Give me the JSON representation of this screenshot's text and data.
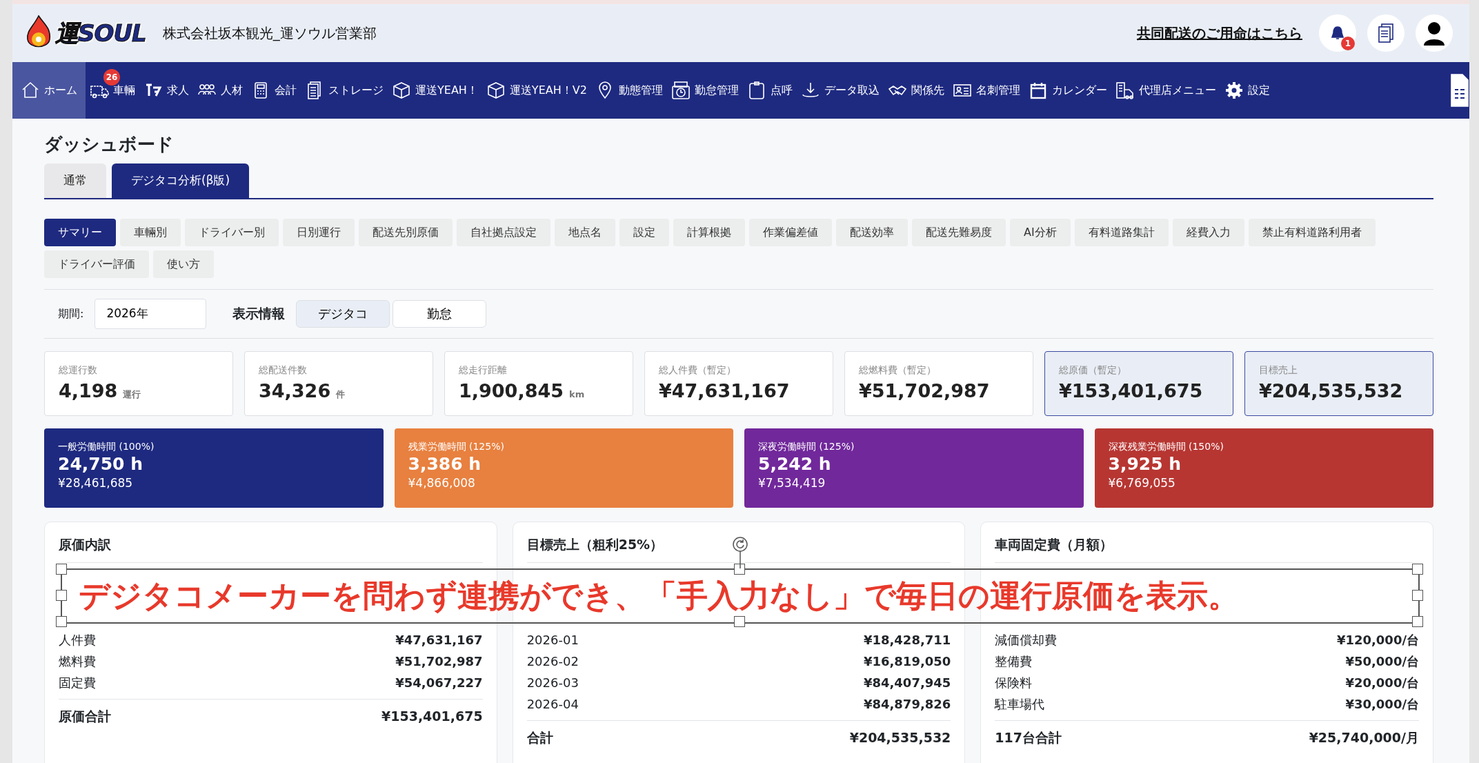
{
  "header": {
    "logo": "運SOUL",
    "company": "株式会社坂本観光_運ソウル営業部",
    "link": "共同配送のご用命はこちら",
    "notification_count": "1"
  },
  "nav": [
    {
      "label": "ホーム",
      "selected": true
    },
    {
      "label": "車輛",
      "selected": false,
      "badge": "26"
    },
    {
      "label": "求人",
      "selected": false
    },
    {
      "label": "人材",
      "selected": false
    },
    {
      "label": "会計",
      "selected": false
    },
    {
      "label": "ストレージ",
      "selected": false
    },
    {
      "label": "運送YEAH！",
      "selected": false
    },
    {
      "label": "運送YEAH！V2",
      "selected": false
    },
    {
      "label": "動態管理",
      "selected": false
    },
    {
      "label": "勤怠管理",
      "selected": false
    },
    {
      "label": "点呼",
      "selected": false
    },
    {
      "label": "データ取込",
      "selected": false
    },
    {
      "label": "関係先",
      "selected": false
    },
    {
      "label": "名刺管理",
      "selected": false
    },
    {
      "label": "カレンダー",
      "selected": false
    },
    {
      "label": "代理店メニュー",
      "selected": false
    },
    {
      "label": "設定",
      "selected": false
    }
  ],
  "page_title": "ダッシュボード",
  "tabs": [
    {
      "label": "通常",
      "selected": false
    },
    {
      "label": "デジタコ分析(β版)",
      "selected": true
    }
  ],
  "subtabs": [
    {
      "label": "サマリー",
      "selected": true
    },
    {
      "label": "車輛別",
      "selected": false
    },
    {
      "label": "ドライバー別",
      "selected": false
    },
    {
      "label": "日別運行",
      "selected": false
    },
    {
      "label": "配送先別原価",
      "selected": false
    },
    {
      "label": "自社拠点設定",
      "selected": false
    },
    {
      "label": "地点名",
      "selected": false
    },
    {
      "label": "設定",
      "selected": false
    },
    {
      "label": "計算根拠",
      "selected": false
    },
    {
      "label": "作業偏差値",
      "selected": false
    },
    {
      "label": "配送効率",
      "selected": false
    },
    {
      "label": "配送先難易度",
      "selected": false
    },
    {
      "label": "AI分析",
      "selected": false
    },
    {
      "label": "有料道路集計",
      "selected": false
    },
    {
      "label": "経費入力",
      "selected": false
    },
    {
      "label": "禁止有料道路利用者",
      "selected": false
    },
    {
      "label": "ドライバー評価",
      "selected": false
    },
    {
      "label": "使い方",
      "selected": false
    }
  ],
  "filters": {
    "period_label": "期間:",
    "period_value": "2026年",
    "display_label": "表示情報",
    "display_options": [
      {
        "label": "デジタコ",
        "selected": true
      },
      {
        "label": "勤怠",
        "selected": false
      }
    ]
  },
  "kpis": [
    {
      "label": "総運行数",
      "value": "4,198",
      "unit": "運行",
      "highlighted": false
    },
    {
      "label": "総配送件数",
      "value": "34,326",
      "unit": "件",
      "highlighted": false
    },
    {
      "label": "総走行距離",
      "value": "1,900,845",
      "unit": "km",
      "highlighted": false
    },
    {
      "label": "総人件費（暫定）",
      "value": "¥47,631,167",
      "highlighted": false
    },
    {
      "label": "総燃料費（暫定）",
      "value": "¥51,702,987",
      "highlighted": false
    },
    {
      "label": "総原価（暫定）",
      "value": "¥153,401,675",
      "highlighted": true
    },
    {
      "label": "目標売上",
      "value": "¥204,535,532",
      "highlighted": true
    }
  ],
  "labor": [
    {
      "label": "一般労働時間 (100%)",
      "hours": "24,750 h",
      "amount": "¥28,461,685",
      "color": "#1e2a80"
    },
    {
      "label": "残業労働時間 (125%)",
      "hours": "3,386 h",
      "amount": "¥4,866,008",
      "color": "#e8803f"
    },
    {
      "label": "深夜労働時間 (125%)",
      "hours": "5,242 h",
      "amount": "¥7,534,419",
      "color": "#71289b"
    },
    {
      "label": "深夜残業労働時間 (150%)",
      "hours": "3,925 h",
      "amount": "¥6,769,055",
      "color": "#b73632"
    }
  ],
  "cards": [
    {
      "title": "原価内訳",
      "rows": [
        {
          "label": "人件費",
          "value": "¥47,631,167"
        },
        {
          "label": "燃料費",
          "value": "¥51,702,987"
        },
        {
          "label": "固定費",
          "value": "¥54,067,227"
        }
      ],
      "total_label": "原価合計",
      "total_value": "¥153,401,675"
    },
    {
      "title": "目標売上（粗利25%）",
      "rows": [
        {
          "label": "2026-01",
          "value": "¥18,428,711"
        },
        {
          "label": "2026-02",
          "value": "¥16,819,050"
        },
        {
          "label": "2026-03",
          "value": "¥84,407,945"
        },
        {
          "label": "2026-04",
          "value": "¥84,879,826"
        }
      ],
      "total_label": "合計",
      "total_value": "¥204,535,532"
    },
    {
      "title": "車両固定費（月額）",
      "rows": [
        {
          "label": "減価償却費",
          "value": "¥120,000/台"
        },
        {
          "label": "整備費",
          "value": "¥50,000/台"
        },
        {
          "label": "保険料",
          "value": "¥20,000/台"
        },
        {
          "label": "駐車場代",
          "value": "¥30,000/台"
        }
      ],
      "total_label": "117台合計",
      "total_value": "¥25,740,000/月"
    }
  ],
  "annotation": {
    "text": "デジタコメーカーを問わず連携ができ、「手入力なし」で毎日の運行原価を表示。",
    "selected": true
  }
}
